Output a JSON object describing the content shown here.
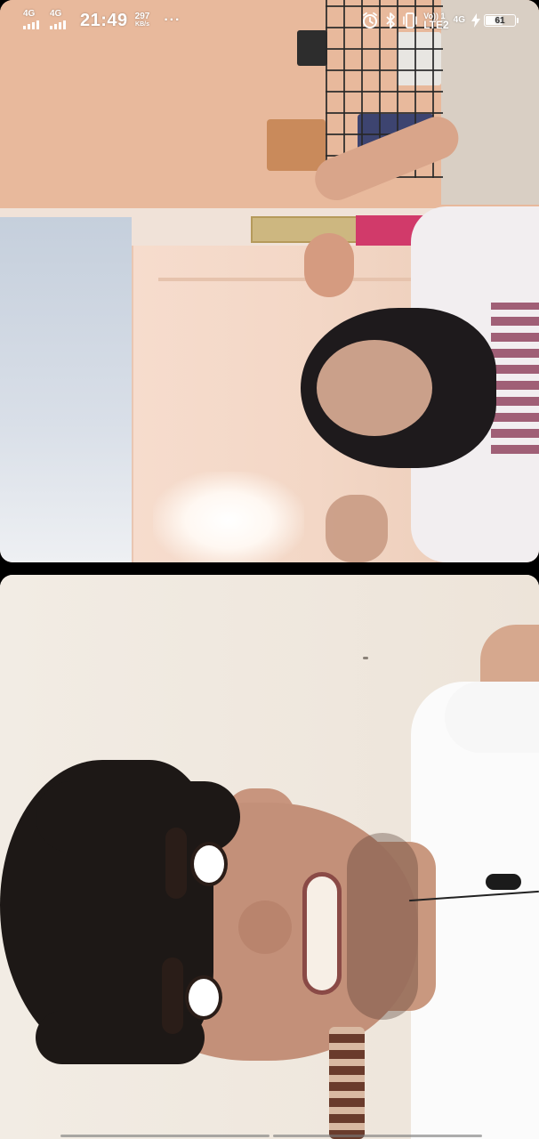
{
  "status_bar": {
    "sim1_label": "4G",
    "sim2_label": "4G",
    "time": "21:49",
    "net_speed_value": "297",
    "net_speed_unit": "KB/s",
    "more_dots": "···",
    "volte_top": "Vo))",
    "volte_sim": "1",
    "volte_bottom": "LTE2",
    "net_type": "4G",
    "battery_percent": "61",
    "battery_level": 0.61,
    "icons": [
      "alarm-icon",
      "bluetooth-icon",
      "vibrate-icon",
      "charging-icon"
    ]
  },
  "call": {
    "tiles": [
      {
        "role": "remote-video"
      },
      {
        "role": "local-video"
      }
    ]
  },
  "colors": {
    "background": "#000000",
    "status_text": "#ffffff"
  }
}
